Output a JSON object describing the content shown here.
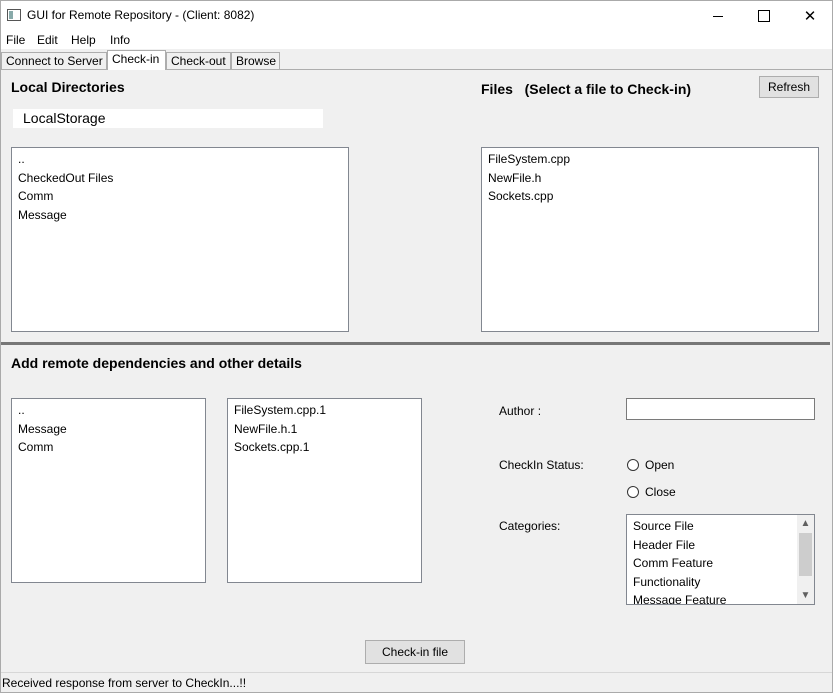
{
  "window": {
    "title": "GUI for Remote Repository - (Client: 8082)",
    "controls": {
      "close": "✕"
    }
  },
  "menu": [
    "File",
    "Edit",
    "Help",
    "Info"
  ],
  "tabs": [
    "Connect to Server",
    "Check-in",
    "Check-out",
    "Browse"
  ],
  "active_tab": "Check-in",
  "local": {
    "title": "Local Directories",
    "path": "LocalStorage",
    "directories": [
      "..",
      "CheckedOut Files",
      "Comm",
      "Message"
    ]
  },
  "files": {
    "title": "Files   (Select a file to Check-in)",
    "refresh_label": "Refresh",
    "items": [
      "FileSystem.cpp",
      "NewFile.h",
      "Sockets.cpp"
    ]
  },
  "dependencies": {
    "title": "Add remote dependencies and other details",
    "directories": [
      "..",
      "Message",
      "Comm"
    ],
    "files": [
      "FileSystem.cpp.1",
      "NewFile.h.1",
      "Sockets.cpp.1"
    ]
  },
  "details": {
    "author_label": "Author :",
    "author_value": "",
    "status_label": "CheckIn Status:",
    "status_options": [
      "Open",
      "Close"
    ],
    "categories_label": "Categories:",
    "categories": [
      "Source File",
      "Header File",
      "Comm Feature",
      "Functionality",
      "Message Feature"
    ],
    "scroll": {
      "up": "▲",
      "down": "▼"
    }
  },
  "checkin_button": "Check-in file",
  "status_message": "Received response from server to CheckIn...!!"
}
